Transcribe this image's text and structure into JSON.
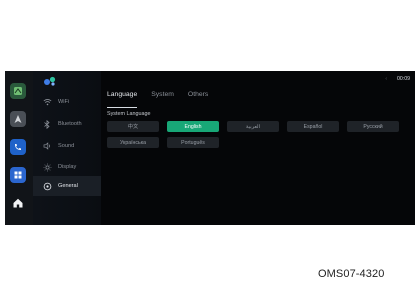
{
  "dock": {
    "items": [
      {
        "name": "maps"
      },
      {
        "name": "navigation"
      },
      {
        "name": "phone"
      },
      {
        "name": "apps"
      },
      {
        "name": "home"
      }
    ]
  },
  "sidebar": {
    "items": [
      {
        "label": "WiFi",
        "icon": "wifi-icon"
      },
      {
        "label": "Bluetooth",
        "icon": "bluetooth-icon"
      },
      {
        "label": "Sound",
        "icon": "speaker-icon"
      },
      {
        "label": "Display",
        "icon": "brightness-icon"
      },
      {
        "label": "General",
        "icon": "gear-icon",
        "active": true
      }
    ]
  },
  "tabs": [
    {
      "label": "Language",
      "active": true
    },
    {
      "label": "System"
    },
    {
      "label": "Others"
    }
  ],
  "section_title": "System Language",
  "languages": {
    "row1": [
      "中文",
      "English",
      "العربية",
      "Español",
      "Русский"
    ],
    "row2": [
      "Українська",
      "Português"
    ],
    "selected": "English"
  },
  "status": {
    "time": "00:09",
    "arrow": "‹"
  },
  "caption": "OMS07-4320",
  "colors": {
    "accent": "#18a777",
    "screen_bg": "#050608",
    "button_bg": "#1f2328"
  }
}
